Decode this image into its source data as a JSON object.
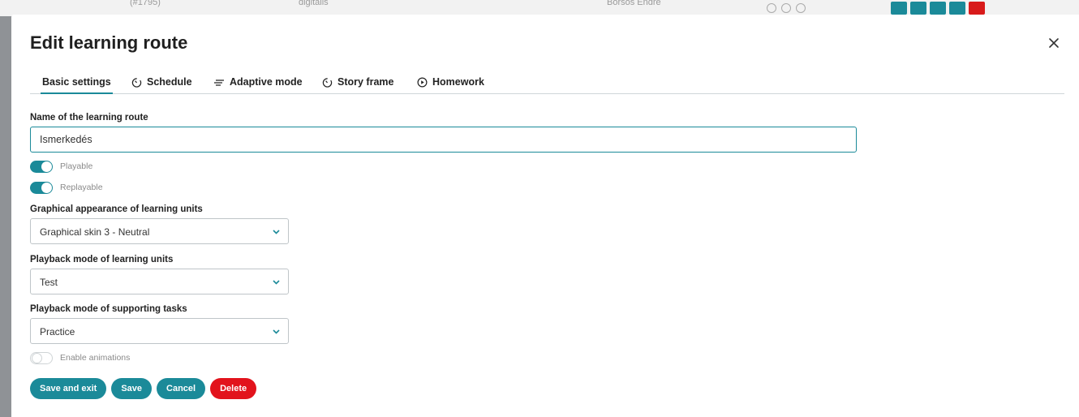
{
  "background": {
    "row_text_left": "(#1795)",
    "row_text_mid": "digitális",
    "row_text_author": "Borsos Endre"
  },
  "modal": {
    "title": "Edit learning route"
  },
  "tabs": [
    {
      "label": "Basic settings",
      "icon": "none",
      "active": true
    },
    {
      "label": "Schedule",
      "icon": "timer-icon",
      "active": false
    },
    {
      "label": "Adaptive mode",
      "icon": "lines-icon",
      "active": false
    },
    {
      "label": "Story frame",
      "icon": "timer-icon",
      "active": false
    },
    {
      "label": "Homework",
      "icon": "play-circle-icon",
      "active": false
    }
  ],
  "form": {
    "name_label": "Name of the learning route",
    "name_value": "Ismerkedés",
    "playable_label": "Playable",
    "playable_on": true,
    "replayable_label": "Replayable",
    "replayable_on": true,
    "graphical_label": "Graphical appearance of learning units",
    "graphical_value": "Graphical skin 3 - Neutral",
    "playback_label": "Playback mode of learning units",
    "playback_value": "Test",
    "supporting_label": "Playback mode of supporting tasks",
    "supporting_value": "Practice",
    "animations_label": "Enable animations",
    "animations_on": false
  },
  "buttons": {
    "save_exit": "Save and exit",
    "save": "Save",
    "cancel": "Cancel",
    "delete": "Delete"
  },
  "colors": {
    "accent": "#1b8a99",
    "danger": "#e2131c"
  }
}
